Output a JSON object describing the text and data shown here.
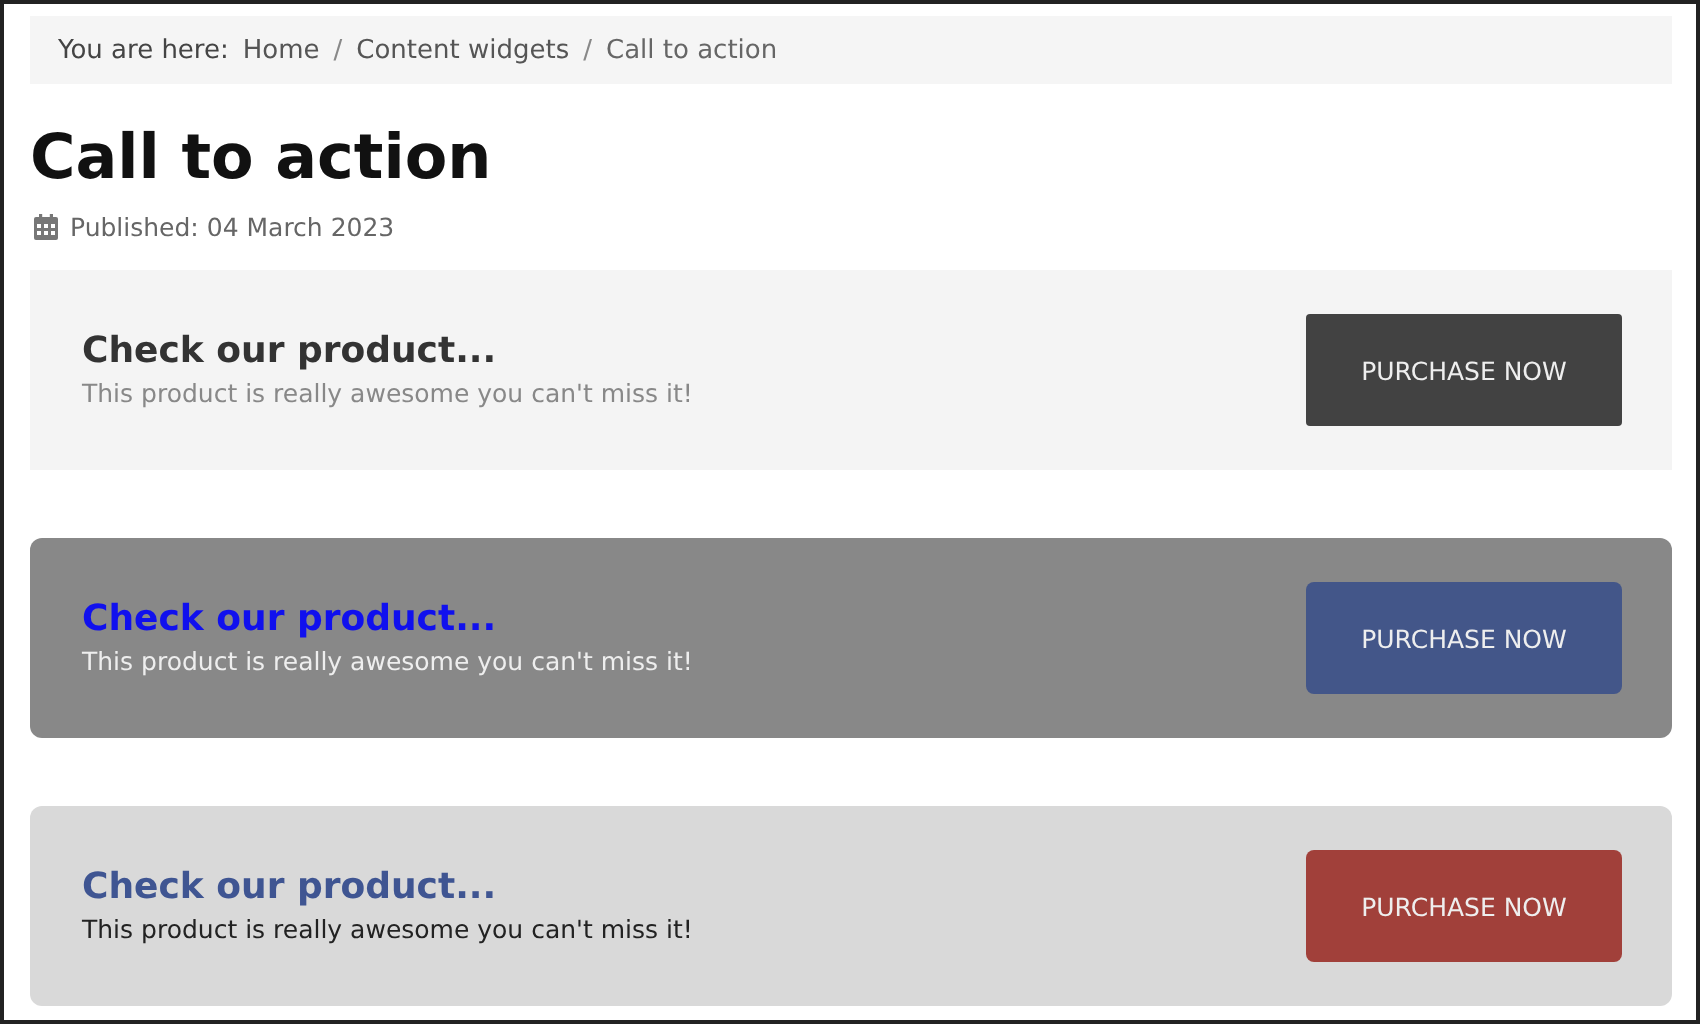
{
  "breadcrumb": {
    "label": "You are here:",
    "items": [
      {
        "text": "Home",
        "kind": "link"
      },
      {
        "text": "Content widgets",
        "kind": "link"
      },
      {
        "text": "Call to action",
        "kind": "current"
      }
    ],
    "separator": "/"
  },
  "page_title": "Call to action",
  "published": "Published: 04 March 2023",
  "banners": [
    {
      "kind": "light",
      "title": "Check our product...",
      "text": "This product is really awesome you can't miss it!",
      "button": "PURCHASE NOW"
    },
    {
      "kind": "dark",
      "title": "Check our product...",
      "text": "This product is really awesome you can't miss it!",
      "button": "PURCHASE NOW"
    },
    {
      "kind": "grey",
      "title": "Check our product...",
      "text": "This product is really awesome you can't miss it!",
      "button": "PURCHASE NOW"
    }
  ]
}
